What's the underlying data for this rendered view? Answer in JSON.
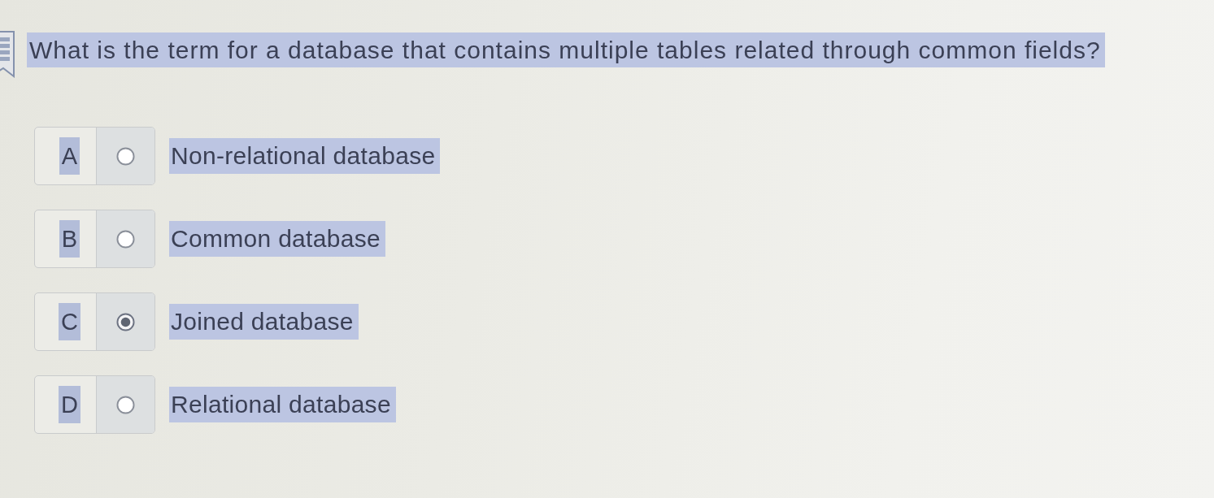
{
  "question": {
    "text": "What is the term for a database that contains multiple tables related through common fields?",
    "highlighted": true
  },
  "options": [
    {
      "letter": "A",
      "label": "Non-relational database",
      "selected": false,
      "highlighted": true
    },
    {
      "letter": "B",
      "label": "Common database",
      "selected": false,
      "highlighted": true
    },
    {
      "letter": "C",
      "label": "Joined database",
      "selected": true,
      "highlighted": true
    },
    {
      "letter": "D",
      "label": "Relational database",
      "selected": false,
      "highlighted": true
    }
  ]
}
